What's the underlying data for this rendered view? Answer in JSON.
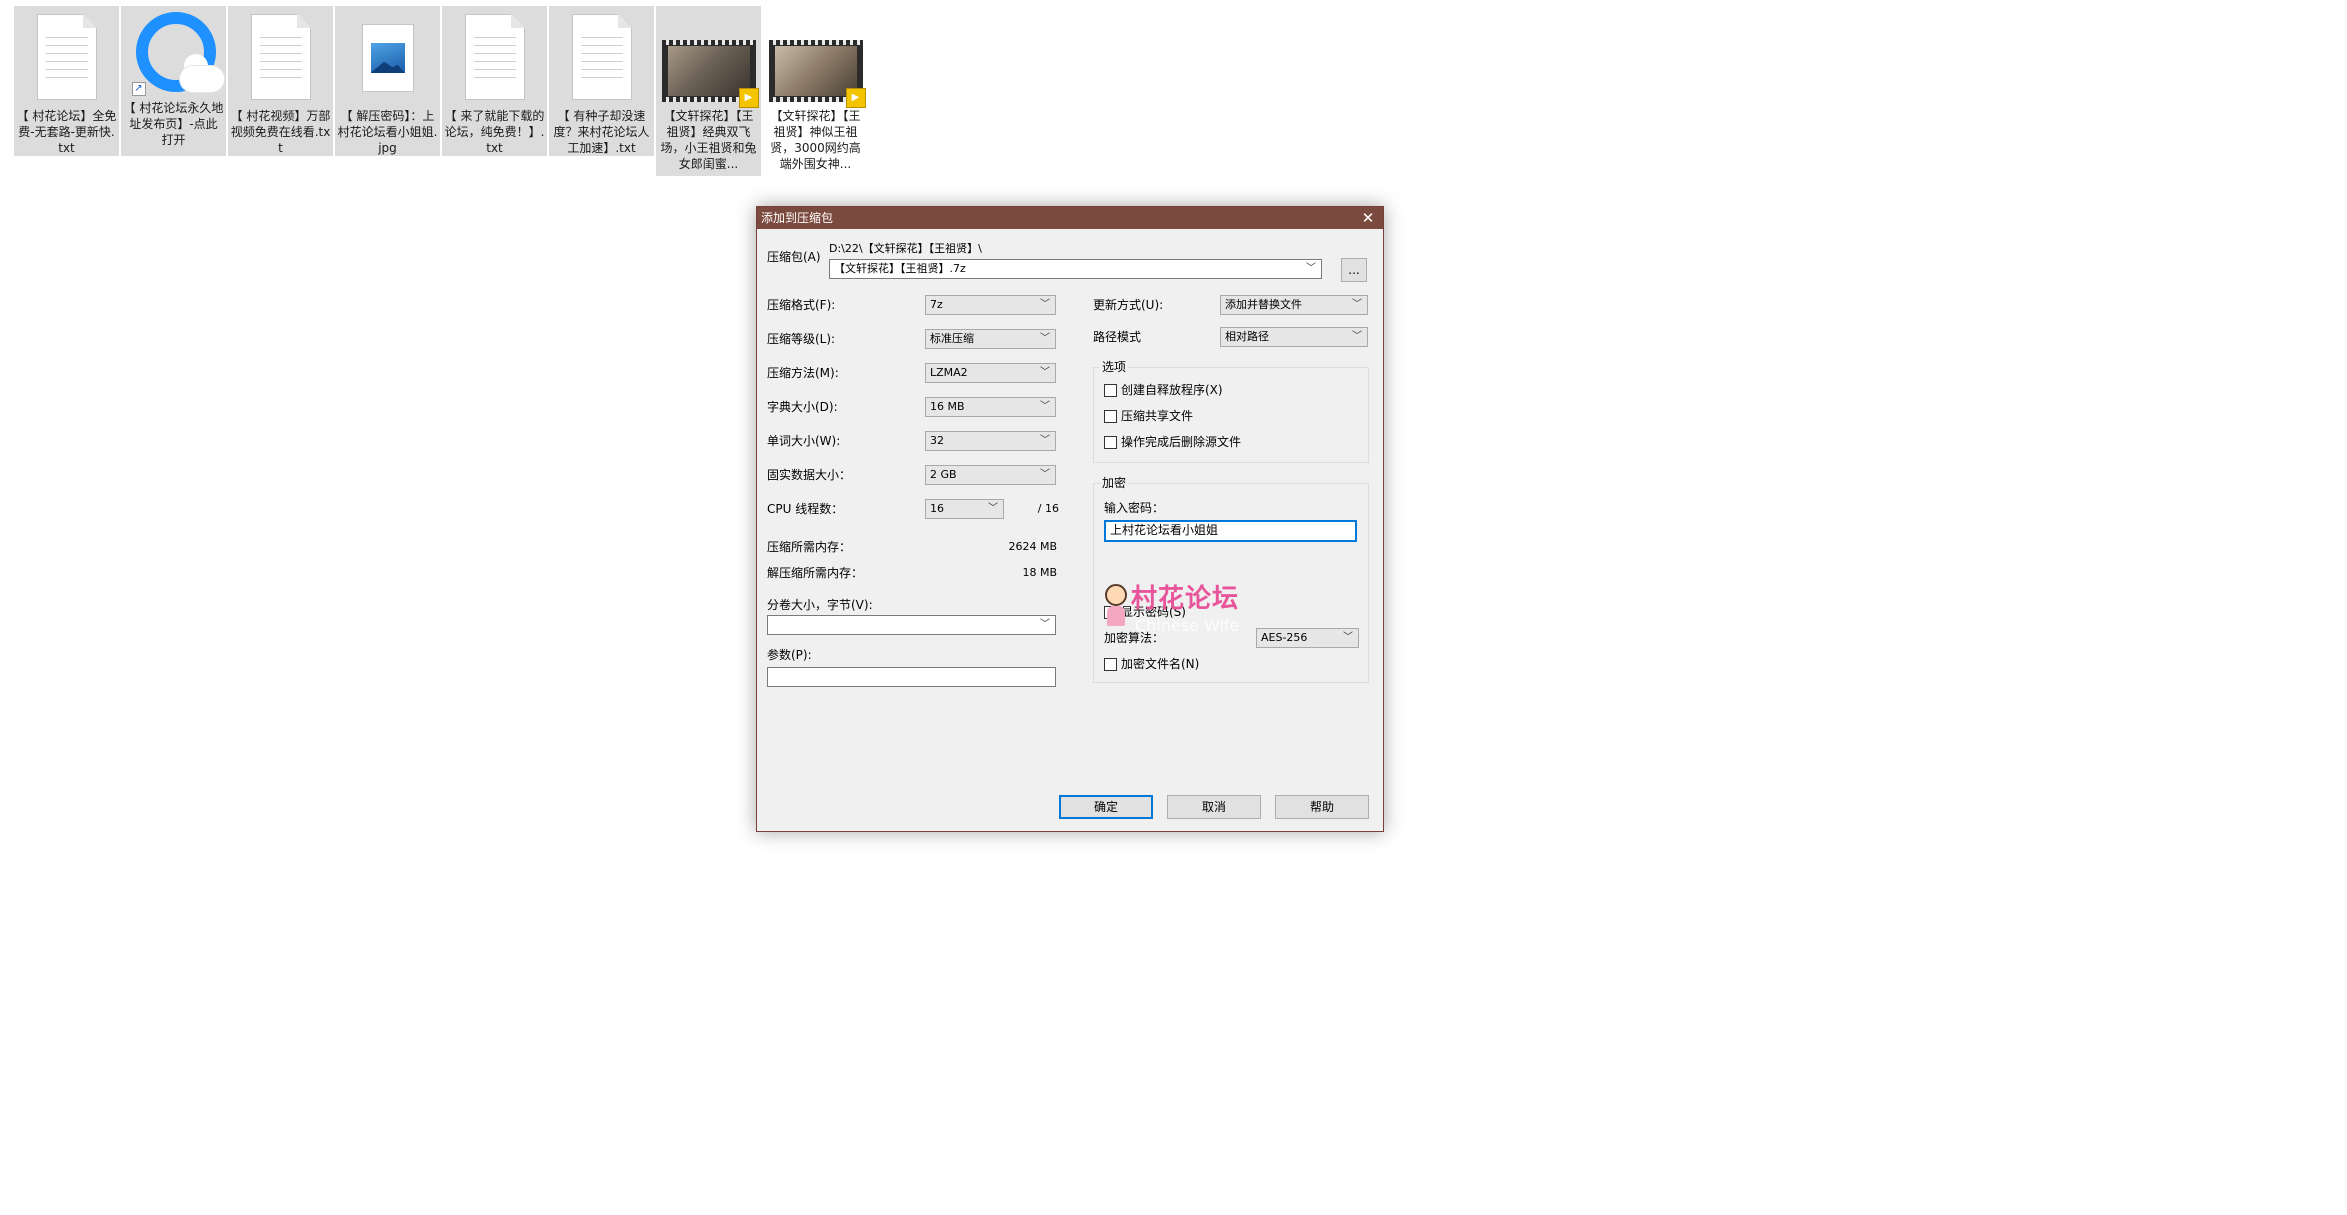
{
  "desktop": {
    "files": [
      {
        "label": "【 村花论坛】全免费-无套路-更新快.txt",
        "type": "txt"
      },
      {
        "label": "【 村花论坛永久地址发布页】-点此打开",
        "type": "shortcut"
      },
      {
        "label": "【 村花视频】万部视频免费在线看.txt",
        "type": "txt"
      },
      {
        "label": "【 解压密码】：上村花论坛看小姐姐.jpg",
        "type": "jpg"
      },
      {
        "label": "【 来了就能下载的论坛，纯免费！】.txt",
        "type": "txt"
      },
      {
        "label": "【 有种子却没速度？来村花论坛人工加速】.txt",
        "type": "txt"
      },
      {
        "label": "【文轩探花】【王祖贤】经典双飞场，小王祖贤和兔女郎闺蜜...",
        "type": "video"
      },
      {
        "label": "【文轩探花】【王祖贤】神似王祖贤，3000网约高端外围女神...",
        "type": "video"
      }
    ]
  },
  "dialog": {
    "title": "添加到压缩包",
    "close_glyph": "✕",
    "archive_label": "压缩包(A)",
    "archive_path": "D:\\22\\【文轩探花】【王祖贤】\\",
    "archive_name": "【文轩探花】【王祖贤】.7z",
    "browse_label": "...",
    "format_label": "压缩格式(F):",
    "format_value": "7z",
    "level_label": "压缩等级(L):",
    "level_value": "标准压缩",
    "method_label": "压缩方法(M):",
    "method_value": "LZMA2",
    "dict_label": "字典大小(D):",
    "dict_value": "16 MB",
    "word_label": "单词大小(W):",
    "word_value": "32",
    "solid_label": "固实数据大小：",
    "solid_value": "2 GB",
    "cpu_label": "CPU 线程数：",
    "cpu_value": "16",
    "cpu_total": "/ 16",
    "mem_compress_label": "压缩所需内存：",
    "mem_compress_value": "2624 MB",
    "mem_decompress_label": "解压缩所需内存：",
    "mem_decompress_value": "18 MB",
    "volume_label": "分卷大小，字节(V):",
    "volume_value": "",
    "params_label": "参数(P):",
    "params_value": "",
    "update_label": "更新方式(U):",
    "update_value": "添加并替换文件",
    "path_label": "路径模式",
    "path_value": "相对路径",
    "options_title": "选项",
    "opt_sfx": "创建自释放程序(X)",
    "opt_shared": "压缩共享文件",
    "opt_delete": "操作完成后删除源文件",
    "encrypt_title": "加密",
    "password_label": "输入密码：",
    "password_value": "上村花论坛看小姐姐",
    "show_password": "显示密码(S)",
    "enc_method_label": "加密算法：",
    "enc_method_value": "AES-256",
    "enc_names": "加密文件名(N)",
    "ok_label": "确定",
    "cancel_label": "取消",
    "help_label": "帮助"
  },
  "watermark": {
    "text": "村花论坛",
    "sub": "Chinese Wife"
  }
}
